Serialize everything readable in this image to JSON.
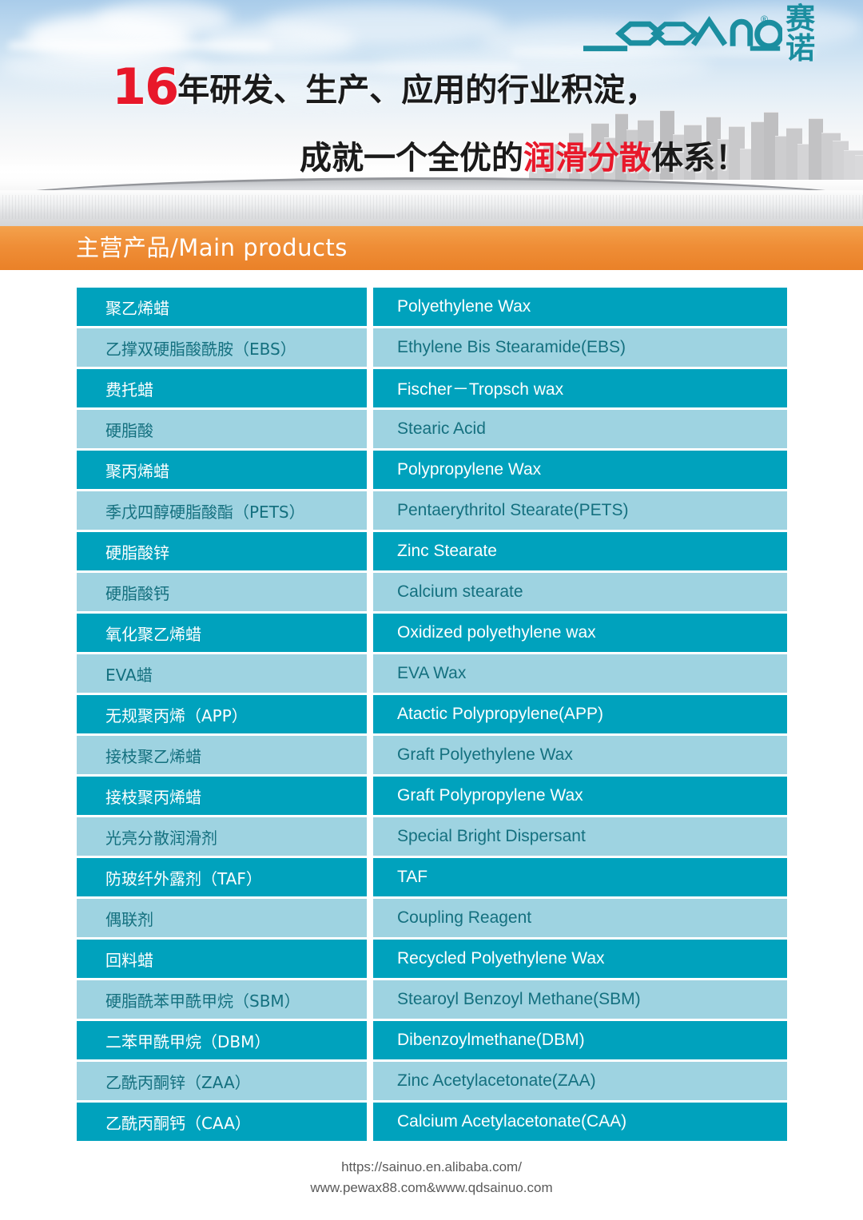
{
  "brand": {
    "logo_mark": "sainuo-hexagon-logo",
    "logo_latin": "SAINUO",
    "logo_chinese": "赛诺",
    "registered_mark": "®"
  },
  "banner": {
    "headline_number": "16",
    "headline_line1": "年研发、生产、应用的行业积淀，",
    "headline_line2_before": "成就一个全优的",
    "headline_line2_highlight": "润滑分散",
    "headline_line2_after": "体系！",
    "highlight_color": "#e8182a"
  },
  "section": {
    "title": "主营产品/Main products",
    "bar_color": "#ea8128"
  },
  "table": {
    "row_color_dark": "#00a2bd",
    "row_color_light": "#9ed3e1",
    "rows": [
      {
        "cn": "聚乙烯蜡",
        "en": "Polyethylene Wax"
      },
      {
        "cn": "乙撑双硬脂酸酰胺（EBS）",
        "en": "Ethylene Bis Stearamide(EBS)"
      },
      {
        "cn": "费托蜡",
        "en": "Fischer－Tropsch wax"
      },
      {
        "cn": "硬脂酸",
        "en": "Stearic Acid"
      },
      {
        "cn": "聚丙烯蜡",
        "en": "Polypropylene Wax"
      },
      {
        "cn": "季戊四醇硬脂酸酯（PETS）",
        "en": "Pentaerythritol Stearate(PETS)"
      },
      {
        "cn": "硬脂酸锌",
        "en": "Zinc Stearate"
      },
      {
        "cn": "硬脂酸钙",
        "en": "Calcium stearate"
      },
      {
        "cn": "氧化聚乙烯蜡",
        "en": "Oxidized polyethylene wax"
      },
      {
        "cn": "EVA蜡",
        "en": "EVA Wax"
      },
      {
        "cn": "无规聚丙烯（APP）",
        "en": "Atactic Polypropylene(APP)"
      },
      {
        "cn": "接枝聚乙烯蜡",
        "en": "Graft Polyethylene Wax"
      },
      {
        "cn": "接枝聚丙烯蜡",
        "en": "Graft Polypropylene Wax"
      },
      {
        "cn": "光亮分散润滑剂",
        "en": "Special Bright Dispersant"
      },
      {
        "cn": "防玻纤外露剂（TAF）",
        "en": "TAF"
      },
      {
        "cn": "偶联剂",
        "en": "Coupling Reagent"
      },
      {
        "cn": "回料蜡",
        "en": "Recycled Polyethylene Wax"
      },
      {
        "cn": "硬脂酰苯甲酰甲烷（SBM）",
        "en": "Stearoyl Benzoyl Methane(SBM)"
      },
      {
        "cn": "二苯甲酰甲烷（DBM）",
        "en": "Dibenzoylmethane(DBM)"
      },
      {
        "cn": "乙酰丙酮锌（ZAA）",
        "en": "Zinc Acetylacetonate(ZAA)"
      },
      {
        "cn": "乙酰丙酮钙（CAA）",
        "en": "Calcium Acetylacetonate(CAA)"
      }
    ]
  },
  "footer": {
    "line1": "https://sainuo.en.alibaba.com/",
    "line2": "www.pewax88.com&www.qdsainuo.com"
  }
}
